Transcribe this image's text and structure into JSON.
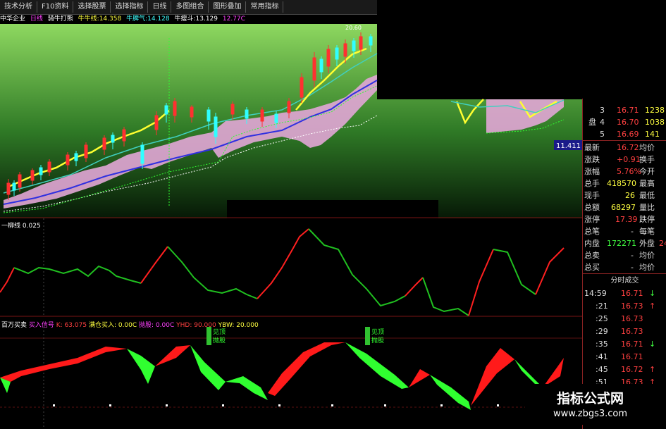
{
  "toolbar": {
    "buttons": [
      "技术分析",
      "F10资料",
      "选择股票",
      "选择指标",
      "日线",
      "多图组合",
      "图形叠加",
      "常用指标"
    ]
  },
  "chart_header": {
    "stock": "中华企业",
    "period": "日线",
    "indicator": "骑牛打熊",
    "item_a": "牛牛线:14.358",
    "item_b": "牛脾气:14.128",
    "item_c": "牛瘦斗:13.129",
    "item_d": "12.77C"
  },
  "price_panel": {
    "price_tag": "11.411",
    "top_value": "20.60"
  },
  "osc_panel": {
    "label": "一柳线",
    "value": "0.025"
  },
  "lower_panel": {
    "label": "百万买卖",
    "item_a": "买入信号",
    "item_b": "K: 63.075",
    "item_c": "满仓买入: 0.00C",
    "item_d": "抛股: 0.00C",
    "item_e": "YHD: 90.000",
    "item_f": "YBW: 20.000",
    "flag_a_top": "见顶",
    "flag_a_bottom": "抛股",
    "flag_b_top": "见顶",
    "flag_b_bottom": "抛股"
  },
  "quotes": {
    "order_rows": [
      {
        "idx": "3",
        "price": "16.71",
        "vol": "1238"
      },
      {
        "idx": "4",
        "price": "16.70",
        "vol": "1038"
      },
      {
        "idx": "5",
        "price": "16.69",
        "vol": "141"
      }
    ],
    "side_label": "盘",
    "stats": [
      {
        "k1": "最新",
        "v1": "16.72",
        "k2": "均价",
        "color": "#ff4040"
      },
      {
        "k1": "涨跌",
        "v1": "+0.91",
        "k2": "换手",
        "color": "#ff4040"
      },
      {
        "k1": "涨幅",
        "v1": "5.76%",
        "k2": "今开",
        "color": "#ff4040"
      },
      {
        "k1": "总手",
        "v1": "418570",
        "k2": "最高",
        "color": "#ffff40"
      },
      {
        "k1": "现手",
        "v1": "26",
        "k2": "最低",
        "color": "#ffff40"
      },
      {
        "k1": "总额",
        "v1": "68297",
        "k2": "量比",
        "color": "#ffff40"
      },
      {
        "k1": "涨停",
        "v1": "17.39",
        "k2": "跌停",
        "color": "#ff4040"
      },
      {
        "k1": "总笔",
        "v1": "-",
        "k2": "每笔",
        "color": "#ddd"
      },
      {
        "k1": "内盘",
        "v1": "172271",
        "k2": "外盘",
        "color": "#40ff40",
        "v2": "24"
      },
      {
        "k1": "总卖",
        "v1": "-",
        "k2": "均价",
        "color": "#ddd"
      },
      {
        "k1": "总买",
        "v1": "-",
        "k2": "均价",
        "color": "#ddd"
      }
    ],
    "ticks_title": "分时成交",
    "ticks": [
      {
        "time": "14:59",
        "price": "16.71",
        "arrow": "↓",
        "dir": "down"
      },
      {
        "time": ":21",
        "price": "16.73",
        "arrow": "↑",
        "dir": "up"
      },
      {
        "time": ":25",
        "price": "16.73",
        "arrow": "",
        "dir": "up"
      },
      {
        "time": ":29",
        "price": "16.73",
        "arrow": "",
        "dir": "up"
      },
      {
        "time": ":35",
        "price": "16.71",
        "arrow": "↓",
        "dir": "down"
      },
      {
        "time": ":41",
        "price": "16.71",
        "arrow": "",
        "dir": "up"
      },
      {
        "time": ":45",
        "price": "16.72",
        "arrow": "↑",
        "dir": "up"
      },
      {
        "time": ":51",
        "price": "16.73",
        "arrow": "↑",
        "dir": "up"
      }
    ]
  },
  "watermark": {
    "title": "指标公式网",
    "url": "www.zbgs3.com"
  },
  "colors": {
    "up": "#ff3030",
    "down": "#30ff30",
    "bg_green_top": "#8ed860",
    "bg_green_bottom": "#0a2a0a",
    "pink_band": "#e2a6d6",
    "ma_blue": "#3030e0",
    "ma_cyan": "#40d0c0",
    "grid_red": "#7a1414"
  }
}
